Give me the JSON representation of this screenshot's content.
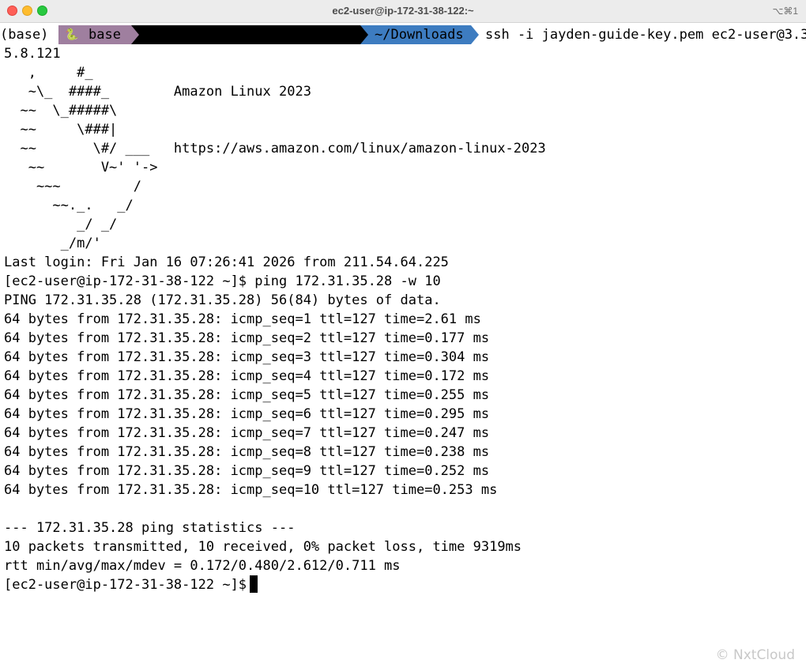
{
  "window": {
    "title": "ec2-user@ip-172-31-38-122:~",
    "shortcut": "⌥⌘1"
  },
  "prompt": {
    "conda_env": "(base)",
    "env_icon": "snake-icon",
    "env_label": "base",
    "directory": "~/Downloads",
    "command": "ssh -i jayden-guide-key.pem ec2-user@3.3"
  },
  "output_lines": [
    "5.8.121",
    "   ,     #_",
    "   ~\\_  ####_        Amazon Linux 2023",
    "  ~~  \\_#####\\",
    "  ~~     \\###|",
    "  ~~       \\#/ ___   https://aws.amazon.com/linux/amazon-linux-2023",
    "   ~~       V~' '->",
    "    ~~~         /",
    "      ~~._.   _/",
    "         _/ _/",
    "       _/m/'",
    "Last login: Fri Jan 16 07:26:41 2026 from 211.54.64.225",
    "[ec2-user@ip-172-31-38-122 ~]$ ping 172.31.35.28 -w 10",
    "PING 172.31.35.28 (172.31.35.28) 56(84) bytes of data.",
    "64 bytes from 172.31.35.28: icmp_seq=1 ttl=127 time=2.61 ms",
    "64 bytes from 172.31.35.28: icmp_seq=2 ttl=127 time=0.177 ms",
    "64 bytes from 172.31.35.28: icmp_seq=3 ttl=127 time=0.304 ms",
    "64 bytes from 172.31.35.28: icmp_seq=4 ttl=127 time=0.172 ms",
    "64 bytes from 172.31.35.28: icmp_seq=5 ttl=127 time=0.255 ms",
    "64 bytes from 172.31.35.28: icmp_seq=6 ttl=127 time=0.295 ms",
    "64 bytes from 172.31.35.28: icmp_seq=7 ttl=127 time=0.247 ms",
    "64 bytes from 172.31.35.28: icmp_seq=8 ttl=127 time=0.238 ms",
    "64 bytes from 172.31.35.28: icmp_seq=9 ttl=127 time=0.252 ms",
    "64 bytes from 172.31.35.28: icmp_seq=10 ttl=127 time=0.253 ms",
    "",
    "--- 172.31.35.28 ping statistics ---",
    "10 packets transmitted, 10 received, 0% packet loss, time 9319ms",
    "rtt min/avg/max/mdev = 0.172/0.480/2.612/0.711 ms"
  ],
  "current_prompt": "[ec2-user@ip-172-31-38-122 ~]$",
  "watermark": "© NxtCloud",
  "colors": {
    "env_segment": "#9f7f9f",
    "dir_segment": "#3d7cc0",
    "close": "#fe5f57",
    "minimize": "#febc2e",
    "maximize": "#28c840"
  }
}
